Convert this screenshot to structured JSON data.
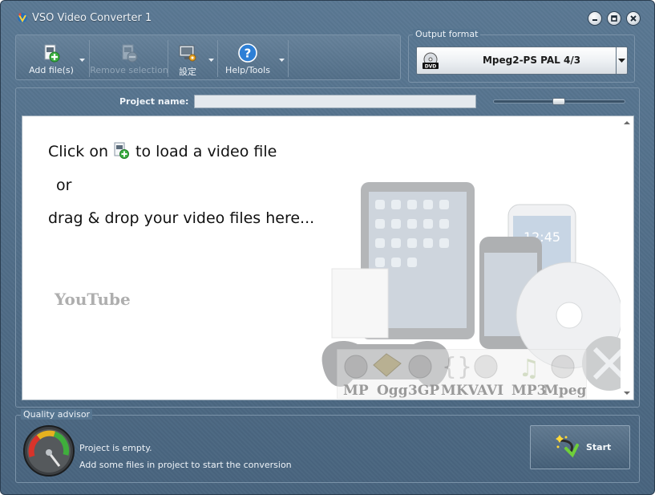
{
  "window": {
    "title": "VSO Video Converter 1"
  },
  "toolbar": {
    "add_files": "Add file(s)",
    "remove_selection": "Remove selection",
    "settings": "設定",
    "help_tools": "Help/Tools"
  },
  "output_format": {
    "label": "Output format",
    "selected": "Mpeg2-PS PAL 4/3"
  },
  "project": {
    "name_label": "Project name:",
    "name_value": ""
  },
  "drop_zone": {
    "line1_before": "Click on",
    "line1_after": "to load a video file",
    "line2": "or",
    "line3": "drag & drop your video files here...",
    "format_badges": [
      "MP",
      "Ogg",
      "3GP",
      "MKV",
      "AVI",
      "MP3",
      "Mpeg"
    ],
    "brand_badge": "YouTube"
  },
  "quality_advisor": {
    "label": "Quality advisor",
    "status": "Project is empty.",
    "hint": "Add some files in project to start the conversion"
  },
  "start": {
    "label": "Start"
  }
}
